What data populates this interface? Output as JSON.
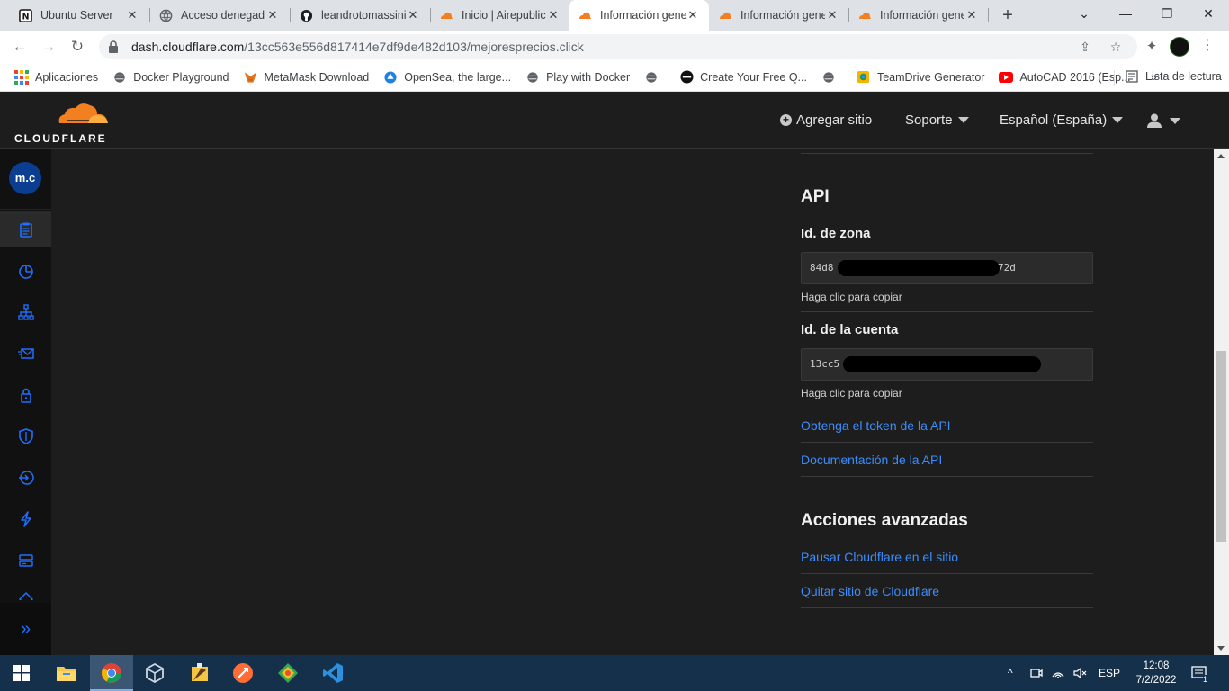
{
  "browser": {
    "tabs": [
      {
        "title": "Ubuntu Server",
        "icon": "notion-icon"
      },
      {
        "title": "Acceso denegado",
        "icon": "globe-icon"
      },
      {
        "title": "leandrotomassini",
        "icon": "github-icon"
      },
      {
        "title": "Inicio | Airepublic",
        "icon": "cloudflare-icon"
      },
      {
        "title": "Información gene",
        "icon": "cloudflare-icon"
      },
      {
        "title": "Información gene",
        "icon": "cloudflare-icon"
      },
      {
        "title": "Información gene",
        "icon": "cloudflare-icon"
      }
    ],
    "url_host": "dash.cloudflare.com",
    "url_path": "/13cc563e556d817414e7df9de482d103/mejoresprecios.click",
    "bookmarks": [
      "Aplicaciones",
      "Docker Playground",
      "MetaMask Download",
      "OpenSea, the large...",
      "Play with Docker",
      "",
      "Create Your Free Q...",
      "",
      "TeamDrive Generator",
      "AutoCAD 2016 (Esp..."
    ],
    "reading_list": "Lista de lectura",
    "overflow": "»"
  },
  "cloudflare": {
    "logo_text": "CLOUDFLARE",
    "nav": {
      "add_site": "Agregar sitio",
      "support": "Soporte",
      "language": "Español (España)"
    },
    "account_initials": "m.c"
  },
  "api_panel": {
    "heading": "API",
    "zone_id_label": "Id. de zona",
    "zone_id_prefix": "84d8",
    "zone_id_suffix": "72d",
    "copy_hint": "Haga clic para copiar",
    "account_id_label": "Id. de la cuenta",
    "account_id_prefix": "13cc5",
    "get_token_link": "Obtenga el token de la API",
    "api_docs_link": "Documentación de la API"
  },
  "advanced": {
    "heading": "Acciones avanzadas",
    "pause_link": "Pausar Cloudflare en el sitio",
    "remove_link": "Quitar sitio de Cloudflare"
  },
  "taskbar": {
    "language": "ESP",
    "time": "12:08",
    "date": "7/2/2022",
    "notifications": "1"
  },
  "colors": {
    "accent_link": "#3b8dff",
    "cloudflare_orange": "#f38020",
    "sidebar_icon": "#1e6fff"
  }
}
